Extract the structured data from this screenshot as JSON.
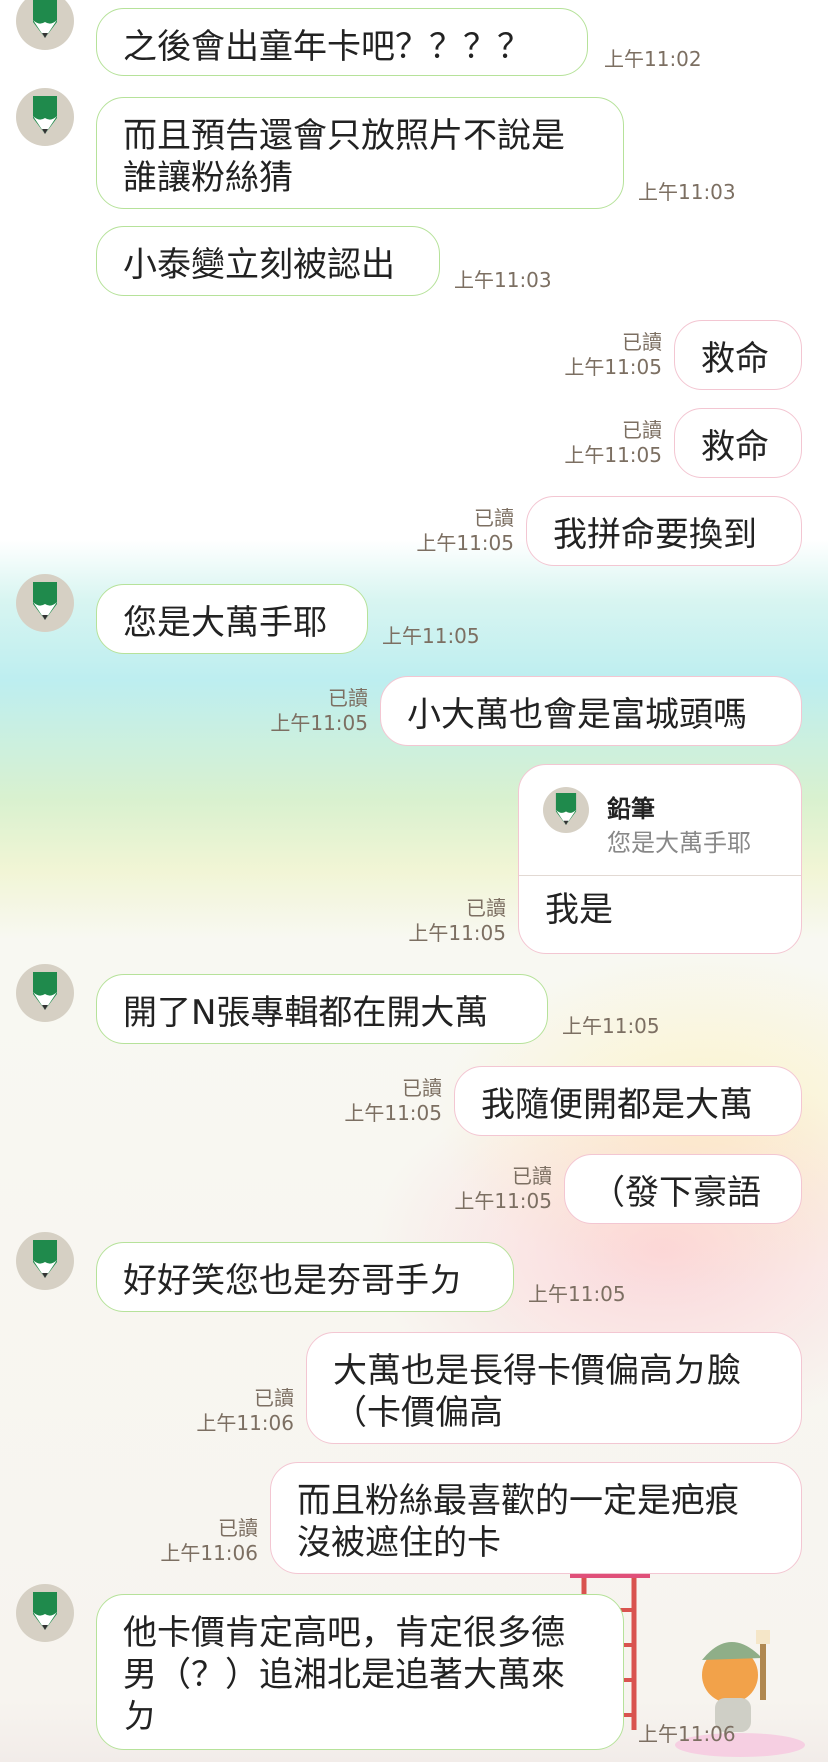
{
  "chat": {
    "read_label": "已讀",
    "messages": [
      {
        "text": "之後會出童年卡吧？？？？",
        "time": "上午11:02"
      },
      {
        "text": "而且預告還會只放照片不說是\n誰讓粉絲猜",
        "time": "上午11:03"
      },
      {
        "text": "小泰變立刻被認出",
        "time": "上午11:03"
      },
      {
        "text": "救命",
        "time": "上午11:05"
      },
      {
        "text": "救命",
        "time": "上午11:05"
      },
      {
        "text": "我拼命要換到",
        "time": "上午11:05"
      },
      {
        "text": "您是大萬手耶",
        "time": "上午11:05"
      },
      {
        "text": "小大萬也會是富城頭嗎",
        "time": "上午11:05"
      },
      {
        "reply_name": "鉛筆",
        "reply_text": "您是大萬手耶",
        "text": "我是",
        "time": "上午11:05"
      },
      {
        "text": "開了N張專輯都在開大萬",
        "time": "上午11:05"
      },
      {
        "text": "我隨便開都是大萬",
        "time": "上午11:05"
      },
      {
        "text": "（發下豪語",
        "time": "上午11:05"
      },
      {
        "text": "好好笑您也是夯哥手ㄉ",
        "time": "上午11:05"
      },
      {
        "text": "大萬也是長得卡價偏高ㄉ臉\n（卡價偏高",
        "time": "上午11:06"
      },
      {
        "text": "而且粉絲最喜歡的一定是疤痕\n沒被遮住的卡",
        "time": "上午11:06"
      },
      {
        "text": "他卡價肯定高吧，肯定很多德\n男（？）追湘北是追著大萬來\nㄉ",
        "time": "上午11:06"
      }
    ]
  },
  "colors": {
    "incoming_border": "#b6e29a",
    "outgoing_border": "#f3c6d2",
    "avatar_bg": "#d6d0c4",
    "pencil_green": "#1f8a4c"
  },
  "icons": {
    "avatar": "pencil-icon",
    "decoration": "sticker-character"
  }
}
